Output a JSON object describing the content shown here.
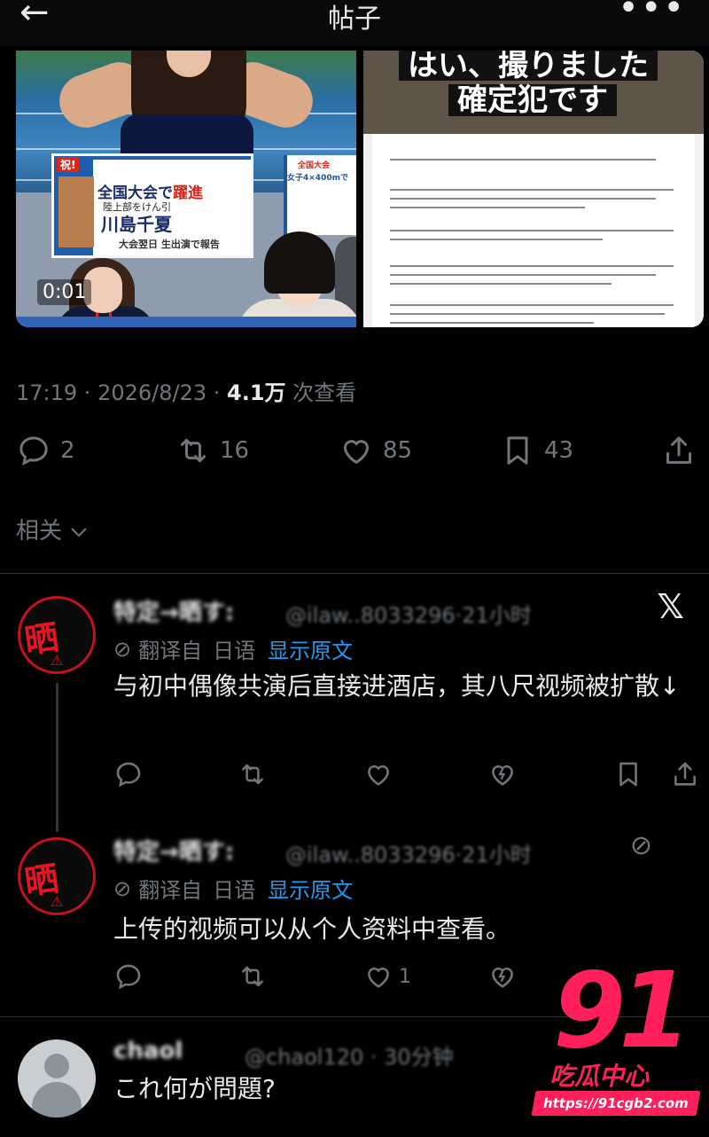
{
  "header": {
    "title": "帖子",
    "back_glyph": "←",
    "more_glyph": "•••"
  },
  "media": {
    "video_timecode": "0:01",
    "broadcast_badge": "祝!",
    "broadcast_line1_a": "全国大会で",
    "broadcast_line1_b": "躍進",
    "broadcast_line2": "陸上部をけん引",
    "broadcast_name": "川島千夏",
    "broadcast_line4": "大会翌日 生出演で報告",
    "side_board_title": "全国大会",
    "side_board_sub": "女子4×400mで",
    "doc_headline_1": "はい、撮りました",
    "doc_headline_2": "確定犯です"
  },
  "post": {
    "time": "17:19",
    "date": "2026/8/23",
    "views": "4.1万",
    "views_label": "次查看",
    "replies": "2",
    "retweets": "16",
    "likes": "85",
    "bookmarks": "43"
  },
  "related_label": "相关",
  "replies": [
    {
      "name": "特定→晒す:",
      "handle": "@ilaw..8033296·21小时",
      "translate_label": "翻译自",
      "translate_lang": "日语",
      "show_original": "显示原文",
      "text": "与初中偶像共演后直接进酒店，其八尺视频被扩散↓",
      "likes": "",
      "avatar_glyph": "晒す!"
    },
    {
      "name": "特定→晒す:",
      "handle": "@ilaw..8033296·21小时",
      "translate_label": "翻译自",
      "translate_lang": "日语",
      "show_original": "显示原文",
      "text": "上传的视频可以从个人资料中查看。",
      "likes": "1",
      "avatar_glyph": "晒す!"
    },
    {
      "name": "chaol",
      "handle": "@chaol120 · 30分钟",
      "text": "これ何が問題?"
    }
  ],
  "watermark": {
    "number": "91",
    "sub": "吃瓜中心",
    "url": "https://91cgb2.com"
  },
  "colors": {
    "accent_blue": "#1d9bf0",
    "muted": "#71767b",
    "watermark_pink": "#ff1f5a",
    "avatar_red": "#e8141f"
  },
  "icons": [
    "arrow-left-icon",
    "more-dots-icon",
    "reply-icon",
    "retweet-icon",
    "like-icon",
    "bookmark-icon",
    "share-icon",
    "chevron-down-icon",
    "translate-icon",
    "x-logo-icon",
    "broken-heart-icon",
    "no-entry-icon"
  ]
}
